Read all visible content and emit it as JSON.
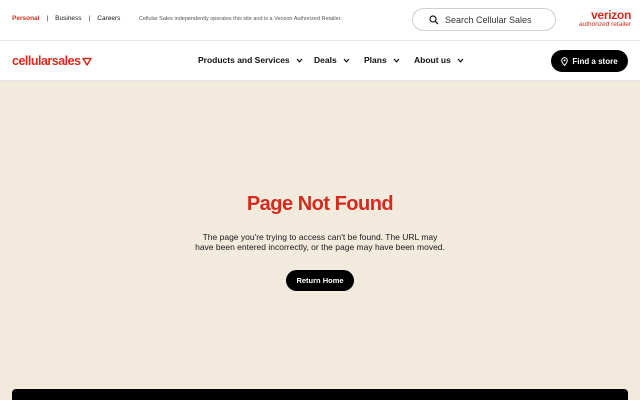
{
  "topbar": {
    "segments": [
      "Personal",
      "Business",
      "Careers"
    ],
    "separator": "|",
    "disclaimer": "Cellular Sales independently operates this site and is a Verizon Authorized Retailer.",
    "search_placeholder": "Search Cellular Sales",
    "partner_logo": {
      "line1": "verizon",
      "line2": "authorized retailer"
    }
  },
  "nav": {
    "brand": "cellularsales",
    "items": [
      "Products and Services",
      "Deals",
      "Plans",
      "About us"
    ],
    "find_store": "Find a store"
  },
  "main": {
    "title": "Page Not Found",
    "message": "The page you're trying to access can't be found. The URL may have been entered incorrectly, or the page may have been moved.",
    "button": "Return Home"
  },
  "colors": {
    "brand_red": "#d52b1e",
    "background": "#f1eadd",
    "button": "#000000"
  },
  "icons": [
    "search-icon",
    "chevron-down-icon",
    "location-pin-icon",
    "brand-triangle-icon"
  ]
}
